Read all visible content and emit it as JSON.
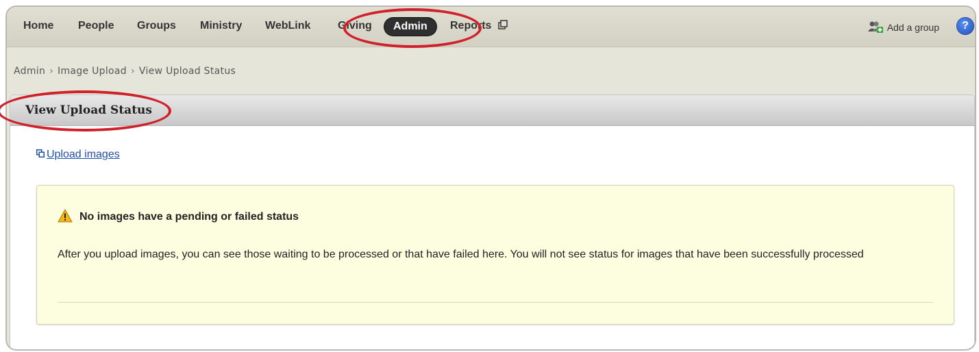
{
  "nav": {
    "items": [
      "Home",
      "People",
      "Groups",
      "Ministry",
      "WebLink",
      "Giving"
    ],
    "active": "Admin",
    "reports": "Reports",
    "add_group": "Add a group",
    "help": "?"
  },
  "breadcrumb": [
    "Admin",
    "Image Upload",
    "View Upload Status"
  ],
  "panel": {
    "title": "View Upload Status",
    "upload_link": "Upload images"
  },
  "notice": {
    "title": "No images have a pending or failed status",
    "body": "After you upload images, you can see those waiting to be processed or that have failed here. You will not see status for images that have been successfully processed"
  },
  "colors": {
    "highlight_ring": "#d0202a",
    "notice_bg": "#fdfde0",
    "link": "#1f4fa8",
    "active_tab": "#2f2f2f"
  },
  "icons": [
    "external-window-icon",
    "add-group-icon",
    "help-icon",
    "new-window-link-icon",
    "warning-icon"
  ]
}
